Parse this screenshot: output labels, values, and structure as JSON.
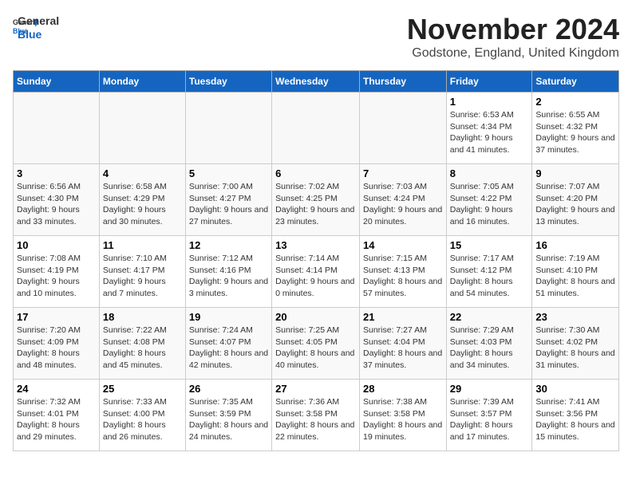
{
  "header": {
    "logo_line1": "General",
    "logo_line2": "Blue",
    "month": "November 2024",
    "location": "Godstone, England, United Kingdom"
  },
  "weekdays": [
    "Sunday",
    "Monday",
    "Tuesday",
    "Wednesday",
    "Thursday",
    "Friday",
    "Saturday"
  ],
  "weeks": [
    [
      {
        "day": "",
        "info": ""
      },
      {
        "day": "",
        "info": ""
      },
      {
        "day": "",
        "info": ""
      },
      {
        "day": "",
        "info": ""
      },
      {
        "day": "",
        "info": ""
      },
      {
        "day": "1",
        "info": "Sunrise: 6:53 AM\nSunset: 4:34 PM\nDaylight: 9 hours and 41 minutes."
      },
      {
        "day": "2",
        "info": "Sunrise: 6:55 AM\nSunset: 4:32 PM\nDaylight: 9 hours and 37 minutes."
      }
    ],
    [
      {
        "day": "3",
        "info": "Sunrise: 6:56 AM\nSunset: 4:30 PM\nDaylight: 9 hours and 33 minutes."
      },
      {
        "day": "4",
        "info": "Sunrise: 6:58 AM\nSunset: 4:29 PM\nDaylight: 9 hours and 30 minutes."
      },
      {
        "day": "5",
        "info": "Sunrise: 7:00 AM\nSunset: 4:27 PM\nDaylight: 9 hours and 27 minutes."
      },
      {
        "day": "6",
        "info": "Sunrise: 7:02 AM\nSunset: 4:25 PM\nDaylight: 9 hours and 23 minutes."
      },
      {
        "day": "7",
        "info": "Sunrise: 7:03 AM\nSunset: 4:24 PM\nDaylight: 9 hours and 20 minutes."
      },
      {
        "day": "8",
        "info": "Sunrise: 7:05 AM\nSunset: 4:22 PM\nDaylight: 9 hours and 16 minutes."
      },
      {
        "day": "9",
        "info": "Sunrise: 7:07 AM\nSunset: 4:20 PM\nDaylight: 9 hours and 13 minutes."
      }
    ],
    [
      {
        "day": "10",
        "info": "Sunrise: 7:08 AM\nSunset: 4:19 PM\nDaylight: 9 hours and 10 minutes."
      },
      {
        "day": "11",
        "info": "Sunrise: 7:10 AM\nSunset: 4:17 PM\nDaylight: 9 hours and 7 minutes."
      },
      {
        "day": "12",
        "info": "Sunrise: 7:12 AM\nSunset: 4:16 PM\nDaylight: 9 hours and 3 minutes."
      },
      {
        "day": "13",
        "info": "Sunrise: 7:14 AM\nSunset: 4:14 PM\nDaylight: 9 hours and 0 minutes."
      },
      {
        "day": "14",
        "info": "Sunrise: 7:15 AM\nSunset: 4:13 PM\nDaylight: 8 hours and 57 minutes."
      },
      {
        "day": "15",
        "info": "Sunrise: 7:17 AM\nSunset: 4:12 PM\nDaylight: 8 hours and 54 minutes."
      },
      {
        "day": "16",
        "info": "Sunrise: 7:19 AM\nSunset: 4:10 PM\nDaylight: 8 hours and 51 minutes."
      }
    ],
    [
      {
        "day": "17",
        "info": "Sunrise: 7:20 AM\nSunset: 4:09 PM\nDaylight: 8 hours and 48 minutes."
      },
      {
        "day": "18",
        "info": "Sunrise: 7:22 AM\nSunset: 4:08 PM\nDaylight: 8 hours and 45 minutes."
      },
      {
        "day": "19",
        "info": "Sunrise: 7:24 AM\nSunset: 4:07 PM\nDaylight: 8 hours and 42 minutes."
      },
      {
        "day": "20",
        "info": "Sunrise: 7:25 AM\nSunset: 4:05 PM\nDaylight: 8 hours and 40 minutes."
      },
      {
        "day": "21",
        "info": "Sunrise: 7:27 AM\nSunset: 4:04 PM\nDaylight: 8 hours and 37 minutes."
      },
      {
        "day": "22",
        "info": "Sunrise: 7:29 AM\nSunset: 4:03 PM\nDaylight: 8 hours and 34 minutes."
      },
      {
        "day": "23",
        "info": "Sunrise: 7:30 AM\nSunset: 4:02 PM\nDaylight: 8 hours and 31 minutes."
      }
    ],
    [
      {
        "day": "24",
        "info": "Sunrise: 7:32 AM\nSunset: 4:01 PM\nDaylight: 8 hours and 29 minutes."
      },
      {
        "day": "25",
        "info": "Sunrise: 7:33 AM\nSunset: 4:00 PM\nDaylight: 8 hours and 26 minutes."
      },
      {
        "day": "26",
        "info": "Sunrise: 7:35 AM\nSunset: 3:59 PM\nDaylight: 8 hours and 24 minutes."
      },
      {
        "day": "27",
        "info": "Sunrise: 7:36 AM\nSunset: 3:58 PM\nDaylight: 8 hours and 22 minutes."
      },
      {
        "day": "28",
        "info": "Sunrise: 7:38 AM\nSunset: 3:58 PM\nDaylight: 8 hours and 19 minutes."
      },
      {
        "day": "29",
        "info": "Sunrise: 7:39 AM\nSunset: 3:57 PM\nDaylight: 8 hours and 17 minutes."
      },
      {
        "day": "30",
        "info": "Sunrise: 7:41 AM\nSunset: 3:56 PM\nDaylight: 8 hours and 15 minutes."
      }
    ]
  ]
}
